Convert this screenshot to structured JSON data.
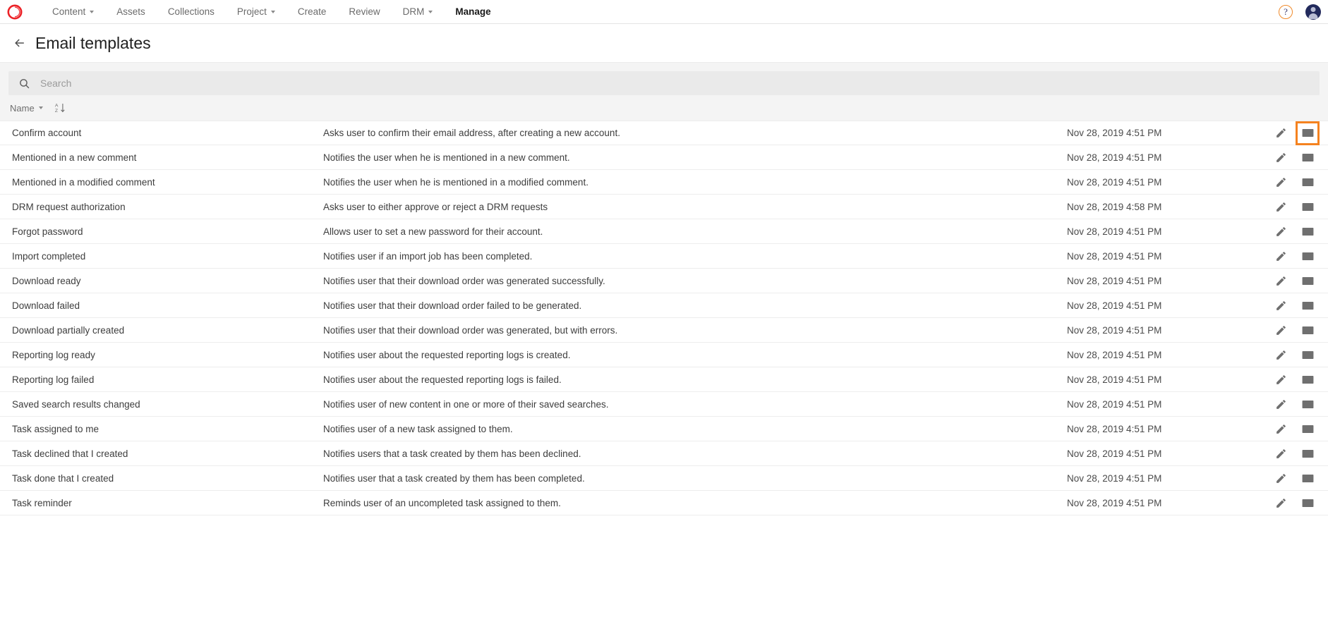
{
  "colors": {
    "accent_orange": "#f5821f",
    "logo_red": "#ec2227",
    "avatar_navy": "#222a5c",
    "icon_gray": "#6f6f6f",
    "search_bg": "#eaeaea",
    "toolbar_bg": "#f4f4f4"
  },
  "topnav": {
    "logo_name": "brand-logo",
    "items": [
      {
        "label": "Content",
        "has_caret": true,
        "active": false
      },
      {
        "label": "Assets",
        "has_caret": false,
        "active": false
      },
      {
        "label": "Collections",
        "has_caret": false,
        "active": false
      },
      {
        "label": "Project",
        "has_caret": true,
        "active": false
      },
      {
        "label": "Create",
        "has_caret": false,
        "active": false
      },
      {
        "label": "Review",
        "has_caret": false,
        "active": false
      },
      {
        "label": "DRM",
        "has_caret": true,
        "active": false
      },
      {
        "label": "Manage",
        "has_caret": false,
        "active": true
      }
    ],
    "help_label": "?",
    "help_icon": "help-circle-icon",
    "avatar_icon": "user-avatar-icon"
  },
  "header": {
    "back_icon": "back-arrow-icon",
    "title": "Email templates"
  },
  "search": {
    "icon": "search-icon",
    "placeholder": "Search",
    "value": ""
  },
  "sort": {
    "field_label": "Name",
    "field_caret_icon": "chevron-down-icon",
    "direction_icon": "sort-az-ascending-icon"
  },
  "table": {
    "rows": [
      {
        "name": "Confirm account",
        "description": "Asks user to confirm their email address, after creating a new account.",
        "date": "Nov 28, 2019 4:51 PM",
        "edit_icon": "pencil-icon",
        "mail_icon": "envelope-icon",
        "mail_highlighted": true
      },
      {
        "name": "Mentioned in a new comment",
        "description": "Notifies the user when he is mentioned in a new comment.",
        "date": "Nov 28, 2019 4:51 PM",
        "edit_icon": "pencil-icon",
        "mail_icon": "envelope-icon",
        "mail_highlighted": false
      },
      {
        "name": "Mentioned in a modified comment",
        "description": "Notifies the user when he is mentioned in a modified comment.",
        "date": "Nov 28, 2019 4:51 PM",
        "edit_icon": "pencil-icon",
        "mail_icon": "envelope-icon",
        "mail_highlighted": false
      },
      {
        "name": "DRM request authorization",
        "description": "Asks user to either approve or reject a DRM requests",
        "date": "Nov 28, 2019 4:58 PM",
        "edit_icon": "pencil-icon",
        "mail_icon": "envelope-icon",
        "mail_highlighted": false
      },
      {
        "name": "Forgot password",
        "description": "Allows user to set a new password for their account.",
        "date": "Nov 28, 2019 4:51 PM",
        "edit_icon": "pencil-icon",
        "mail_icon": "envelope-icon",
        "mail_highlighted": false
      },
      {
        "name": "Import completed",
        "description": "Notifies user if an import job has been completed.",
        "date": "Nov 28, 2019 4:51 PM",
        "edit_icon": "pencil-icon",
        "mail_icon": "envelope-icon",
        "mail_highlighted": false
      },
      {
        "name": "Download ready",
        "description": "Notifies user that their download order was generated successfully.",
        "date": "Nov 28, 2019 4:51 PM",
        "edit_icon": "pencil-icon",
        "mail_icon": "envelope-icon",
        "mail_highlighted": false
      },
      {
        "name": "Download failed",
        "description": "Notifies user that their download order failed to be generated.",
        "date": "Nov 28, 2019 4:51 PM",
        "edit_icon": "pencil-icon",
        "mail_icon": "envelope-icon",
        "mail_highlighted": false
      },
      {
        "name": "Download partially created",
        "description": "Notifies user that their download order was generated, but with errors.",
        "date": "Nov 28, 2019 4:51 PM",
        "edit_icon": "pencil-icon",
        "mail_icon": "envelope-icon",
        "mail_highlighted": false
      },
      {
        "name": "Reporting log ready",
        "description": "Notifies user about the requested reporting logs is created.",
        "date": "Nov 28, 2019 4:51 PM",
        "edit_icon": "pencil-icon",
        "mail_icon": "envelope-icon",
        "mail_highlighted": false
      },
      {
        "name": "Reporting log failed",
        "description": "Notifies user about the requested reporting logs is failed.",
        "date": "Nov 28, 2019 4:51 PM",
        "edit_icon": "pencil-icon",
        "mail_icon": "envelope-icon",
        "mail_highlighted": false
      },
      {
        "name": "Saved search results changed",
        "description": "Notifies user of new content in one or more of their saved searches.",
        "date": "Nov 28, 2019 4:51 PM",
        "edit_icon": "pencil-icon",
        "mail_icon": "envelope-icon",
        "mail_highlighted": false
      },
      {
        "name": "Task assigned to me",
        "description": "Notifies user of a new task assigned to them.",
        "date": "Nov 28, 2019 4:51 PM",
        "edit_icon": "pencil-icon",
        "mail_icon": "envelope-icon",
        "mail_highlighted": false
      },
      {
        "name": "Task declined that I created",
        "description": "Notifies users that a task created by them has been declined.",
        "date": "Nov 28, 2019 4:51 PM",
        "edit_icon": "pencil-icon",
        "mail_icon": "envelope-icon",
        "mail_highlighted": false
      },
      {
        "name": "Task done that I created",
        "description": "Notifies user that a task created by them has been completed.",
        "date": "Nov 28, 2019 4:51 PM",
        "edit_icon": "pencil-icon",
        "mail_icon": "envelope-icon",
        "mail_highlighted": false
      },
      {
        "name": "Task reminder",
        "description": "Reminds user of an uncompleted task assigned to them.",
        "date": "Nov 28, 2019 4:51 PM",
        "edit_icon": "pencil-icon",
        "mail_icon": "envelope-icon",
        "mail_highlighted": false
      }
    ]
  }
}
